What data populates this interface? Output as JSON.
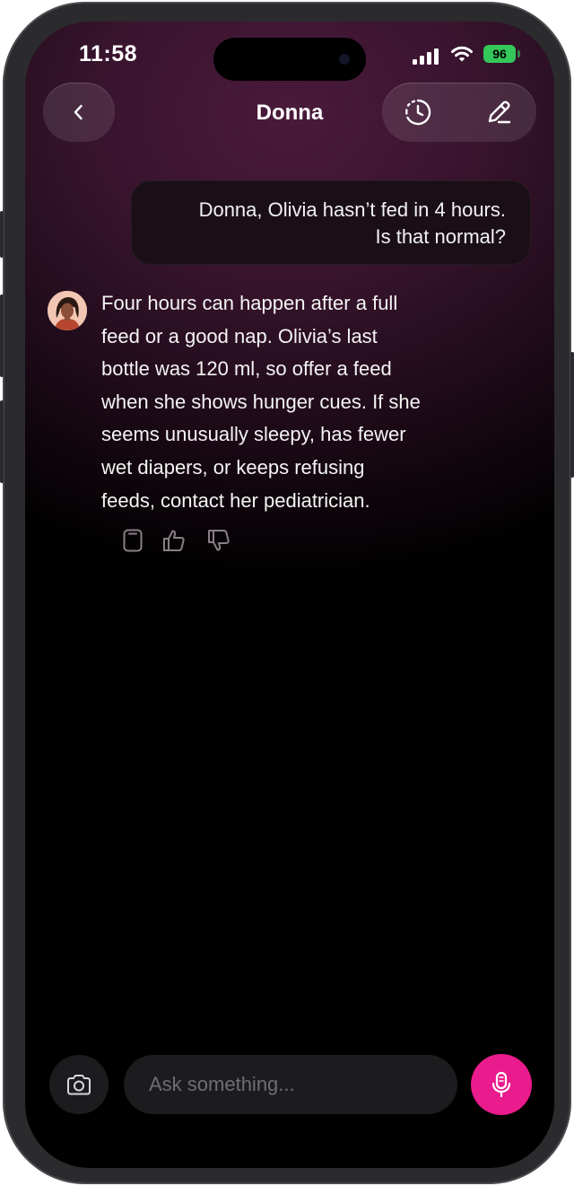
{
  "status_bar": {
    "time": "11:58",
    "battery": "96",
    "icons": [
      "signal-icon",
      "wifi-icon",
      "battery-icon"
    ]
  },
  "header": {
    "title": "Donna",
    "icons": {
      "back": "chevron-left-icon",
      "history": "history-icon",
      "new_chat": "pencil-icon"
    }
  },
  "conversation": {
    "user_message": {
      "line1": "Donna, Olivia hasn’t fed in 4 hours.",
      "line2": "Is that normal?"
    },
    "assistant_message": {
      "lines": [
        "Four hours can happen after a full",
        "feed or a good nap. Olivia’s last",
        "bottle was 120 ml, so offer a feed",
        "when she shows hunger cues. If she",
        "seems unusually sleepy, has fewer",
        "wet diapers, or keeps refusing",
        "feeds, contact her pediatrician."
      ],
      "actions": [
        "copy-icon",
        "thumbs-up-icon",
        "thumbs-down-icon"
      ]
    }
  },
  "composer": {
    "placeholder": "Ask something...",
    "value": "",
    "icons": {
      "camera": "camera-icon",
      "mic": "microphone-icon"
    }
  },
  "colors": {
    "accent": "#ea1b8c",
    "battery": "#34c759",
    "background_top": "#4a1a3b",
    "background_bottom": "#000000"
  }
}
